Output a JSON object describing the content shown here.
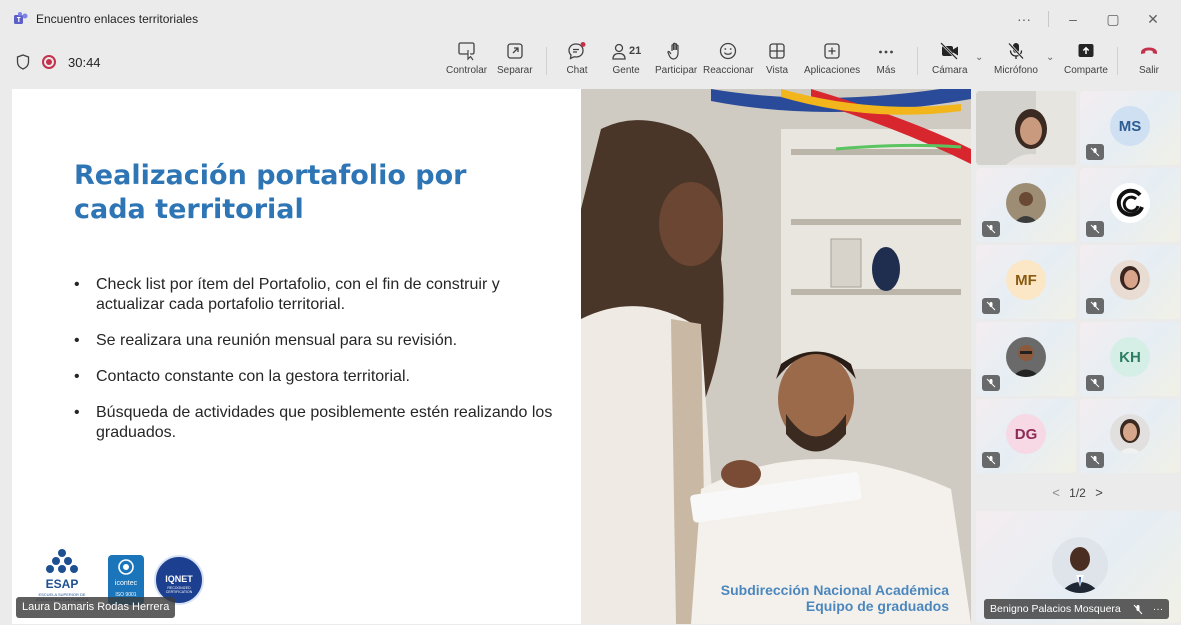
{
  "window": {
    "title": "Encuentro enlaces territoriales",
    "more": "···",
    "minimize": "–",
    "restore": "▢",
    "close": "✕"
  },
  "toolbar": {
    "timer": "30:44",
    "controlar": "Controlar",
    "separar": "Separar",
    "chat": "Chat",
    "gente": "Gente",
    "people_count": "21",
    "participar": "Participar",
    "reaccionar": "Reaccionar",
    "vista": "Vista",
    "aplicaciones": "Aplicaciones",
    "mas": "Más",
    "camara": "Cámara",
    "microfono": "Micrófono",
    "comparte": "Comparte",
    "salir": "Salir",
    "accent_leave": "#c4314b"
  },
  "slide": {
    "title": "Realización portafolio por cada territorial",
    "bullets": [
      "Check list por ítem del Portafolio, con el fin de construir y actualizar cada portafolio territorial.",
      "Se realizara una reunión mensual para su revisión.",
      "Contacto constante con la gestora territorial.",
      "Búsqueda de actividades que posiblemente estén realizando los graduados."
    ],
    "caption_line1": "Subdirección Nacional Académica",
    "caption_line2": "Equipo de graduados",
    "logo_esap": "ESAP",
    "logo_esap_sub": "ESCUELA SUPERIOR DE ADMINISTRACIÓN PÚBLICA",
    "logo_icontec": "icontec",
    "logo_icontec_sub": "ISO 9001",
    "logo_iqnet": "IQNET",
    "logo_iqnet_sub": "RECOGNIZED CERTIFICATION",
    "title_color": "#2e75b6"
  },
  "presenter": {
    "name": "Laura Damaris Rodas Herrera"
  },
  "gallery": {
    "initials": {
      "ms": "MS",
      "mf": "MF",
      "kh": "KH",
      "dg": "DG"
    },
    "pager": "1/2",
    "prev": "<",
    "next": ">",
    "featured_name": "Benigno Palacios Mosquera",
    "featured_more": "···"
  }
}
